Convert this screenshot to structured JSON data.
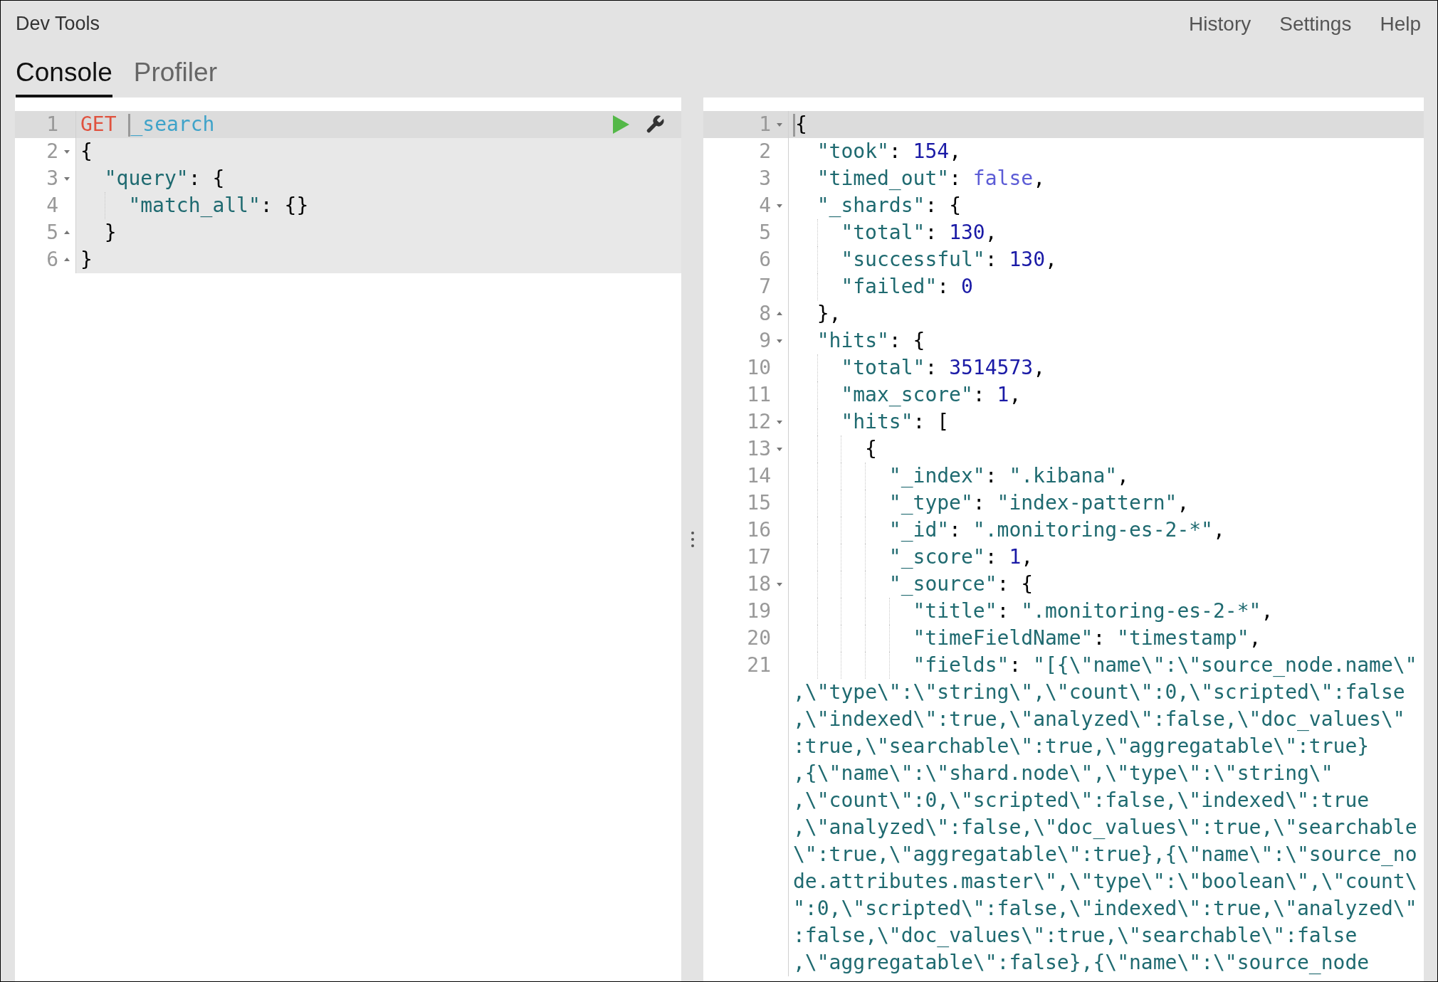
{
  "app_title": "Dev Tools",
  "header_links": [
    "History",
    "Settings",
    "Help"
  ],
  "tabs": [
    {
      "label": "Console",
      "selected": true
    },
    {
      "label": "Profiler",
      "selected": false
    }
  ],
  "request_editor": {
    "lines": [
      {
        "number": "1",
        "fold_start": false,
        "fold_end": false,
        "active": true,
        "in_request": true,
        "tokens": [
          {
            "kind": "method",
            "t": "GET"
          },
          {
            "kind": "cursor"
          },
          {
            "kind": "path",
            "t": "_search"
          }
        ]
      },
      {
        "number": "2",
        "fold_start": true,
        "fold_end": false,
        "active": false,
        "in_request": true,
        "tokens": [
          {
            "kind": "punct",
            "t": "{"
          }
        ]
      },
      {
        "number": "3",
        "fold_start": true,
        "fold_end": false,
        "active": false,
        "in_request": true,
        "tokens": [
          {
            "kind": "key",
            "t": "  \"query\""
          },
          {
            "kind": "punct",
            "t": ": {"
          }
        ]
      },
      {
        "number": "4",
        "fold_start": false,
        "fold_end": false,
        "active": false,
        "in_request": true,
        "tokens": [
          {
            "kind": "key",
            "t": "    \"match_all\""
          },
          {
            "kind": "punct",
            "t": ": {}"
          }
        ]
      },
      {
        "number": "5",
        "fold_start": false,
        "fold_end": true,
        "active": false,
        "in_request": true,
        "tokens": [
          {
            "kind": "punct",
            "t": "  }"
          }
        ]
      },
      {
        "number": "6",
        "fold_start": false,
        "fold_end": true,
        "active": false,
        "in_request": true,
        "tokens": [
          {
            "kind": "punct",
            "t": "}"
          }
        ]
      }
    ]
  },
  "response_editor": {
    "lines": [
      {
        "number": "1",
        "fold_start": true,
        "fold_end": false,
        "active": true,
        "tokens": [
          {
            "kind": "cursor"
          },
          {
            "kind": "punct",
            "t": "{"
          }
        ]
      },
      {
        "number": "2",
        "fold_start": false,
        "fold_end": false,
        "active": false,
        "tokens": [
          {
            "kind": "key",
            "t": "  \"took\""
          },
          {
            "kind": "punct",
            "t": ": "
          },
          {
            "kind": "number",
            "t": "154"
          },
          {
            "kind": "punct",
            "t": ","
          }
        ]
      },
      {
        "number": "3",
        "fold_start": false,
        "fold_end": false,
        "active": false,
        "tokens": [
          {
            "kind": "key",
            "t": "  \"timed_out\""
          },
          {
            "kind": "punct",
            "t": ": "
          },
          {
            "kind": "bool",
            "t": "false"
          },
          {
            "kind": "punct",
            "t": ","
          }
        ]
      },
      {
        "number": "4",
        "fold_start": true,
        "fold_end": false,
        "active": false,
        "tokens": [
          {
            "kind": "key",
            "t": "  \"_shards\""
          },
          {
            "kind": "punct",
            "t": ": {"
          }
        ]
      },
      {
        "number": "5",
        "fold_start": false,
        "fold_end": false,
        "active": false,
        "tokens": [
          {
            "kind": "key",
            "t": "    \"total\""
          },
          {
            "kind": "punct",
            "t": ": "
          },
          {
            "kind": "number",
            "t": "130"
          },
          {
            "kind": "punct",
            "t": ","
          }
        ]
      },
      {
        "number": "6",
        "fold_start": false,
        "fold_end": false,
        "active": false,
        "tokens": [
          {
            "kind": "key",
            "t": "    \"successful\""
          },
          {
            "kind": "punct",
            "t": ": "
          },
          {
            "kind": "number",
            "t": "130"
          },
          {
            "kind": "punct",
            "t": ","
          }
        ]
      },
      {
        "number": "7",
        "fold_start": false,
        "fold_end": false,
        "active": false,
        "tokens": [
          {
            "kind": "key",
            "t": "    \"failed\""
          },
          {
            "kind": "punct",
            "t": ": "
          },
          {
            "kind": "number",
            "t": "0"
          }
        ]
      },
      {
        "number": "8",
        "fold_start": false,
        "fold_end": true,
        "active": false,
        "tokens": [
          {
            "kind": "punct",
            "t": "  },"
          }
        ]
      },
      {
        "number": "9",
        "fold_start": true,
        "fold_end": false,
        "active": false,
        "tokens": [
          {
            "kind": "key",
            "t": "  \"hits\""
          },
          {
            "kind": "punct",
            "t": ": {"
          }
        ]
      },
      {
        "number": "10",
        "fold_start": false,
        "fold_end": false,
        "active": false,
        "tokens": [
          {
            "kind": "key",
            "t": "    \"total\""
          },
          {
            "kind": "punct",
            "t": ": "
          },
          {
            "kind": "number",
            "t": "3514573"
          },
          {
            "kind": "punct",
            "t": ","
          }
        ]
      },
      {
        "number": "11",
        "fold_start": false,
        "fold_end": false,
        "active": false,
        "tokens": [
          {
            "kind": "key",
            "t": "    \"max_score\""
          },
          {
            "kind": "punct",
            "t": ": "
          },
          {
            "kind": "number",
            "t": "1"
          },
          {
            "kind": "punct",
            "t": ","
          }
        ]
      },
      {
        "number": "12",
        "fold_start": true,
        "fold_end": false,
        "active": false,
        "tokens": [
          {
            "kind": "key",
            "t": "    \"hits\""
          },
          {
            "kind": "punct",
            "t": ": ["
          }
        ]
      },
      {
        "number": "13",
        "fold_start": true,
        "fold_end": false,
        "active": false,
        "tokens": [
          {
            "kind": "punct",
            "t": "      {"
          }
        ]
      },
      {
        "number": "14",
        "fold_start": false,
        "fold_end": false,
        "active": false,
        "tokens": [
          {
            "kind": "key",
            "t": "        \"_index\""
          },
          {
            "kind": "punct",
            "t": ": "
          },
          {
            "kind": "string",
            "t": "\".kibana\""
          },
          {
            "kind": "punct",
            "t": ","
          }
        ]
      },
      {
        "number": "15",
        "fold_start": false,
        "fold_end": false,
        "active": false,
        "tokens": [
          {
            "kind": "key",
            "t": "        \"_type\""
          },
          {
            "kind": "punct",
            "t": ": "
          },
          {
            "kind": "string",
            "t": "\"index-pattern\""
          },
          {
            "kind": "punct",
            "t": ","
          }
        ]
      },
      {
        "number": "16",
        "fold_start": false,
        "fold_end": false,
        "active": false,
        "tokens": [
          {
            "kind": "key",
            "t": "        \"_id\""
          },
          {
            "kind": "punct",
            "t": ": "
          },
          {
            "kind": "string",
            "t": "\".monitoring-es-2-*\""
          },
          {
            "kind": "punct",
            "t": ","
          }
        ]
      },
      {
        "number": "17",
        "fold_start": false,
        "fold_end": false,
        "active": false,
        "tokens": [
          {
            "kind": "key",
            "t": "        \"_score\""
          },
          {
            "kind": "punct",
            "t": ": "
          },
          {
            "kind": "number",
            "t": "1"
          },
          {
            "kind": "punct",
            "t": ","
          }
        ]
      },
      {
        "number": "18",
        "fold_start": true,
        "fold_end": false,
        "active": false,
        "tokens": [
          {
            "kind": "key",
            "t": "        \"_source\""
          },
          {
            "kind": "punct",
            "t": ": {"
          }
        ]
      },
      {
        "number": "19",
        "fold_start": false,
        "fold_end": false,
        "active": false,
        "tokens": [
          {
            "kind": "key",
            "t": "          \"title\""
          },
          {
            "kind": "punct",
            "t": ": "
          },
          {
            "kind": "string",
            "t": "\".monitoring-es-2-*\""
          },
          {
            "kind": "punct",
            "t": ","
          }
        ]
      },
      {
        "number": "20",
        "fold_start": false,
        "fold_end": false,
        "active": false,
        "tokens": [
          {
            "kind": "key",
            "t": "          \"timeFieldName\""
          },
          {
            "kind": "punct",
            "t": ": "
          },
          {
            "kind": "string",
            "t": "\"timestamp\""
          },
          {
            "kind": "punct",
            "t": ","
          }
        ]
      },
      {
        "number": "21",
        "fold_start": false,
        "fold_end": false,
        "active": false,
        "tokens": [
          {
            "kind": "key",
            "t": "          \"fields\""
          },
          {
            "kind": "punct",
            "t": ": "
          },
          {
            "kind": "string",
            "t": "\"[{\\\"name\\\":\\\"source_node.name\\\""
          }
        ],
        "wrapped": [
          ",\\\"type\\\":\\\"string\\\",\\\"count\\\":0,\\\"scripted\\\":false",
          ",\\\"indexed\\\":true,\\\"analyzed\\\":false,\\\"doc_values\\\"",
          ":true,\\\"searchable\\\":true,\\\"aggregatable\\\":true}",
          ",{\\\"name\\\":\\\"shard.node\\\",\\\"type\\\":\\\"string\\\"",
          ",\\\"count\\\":0,\\\"scripted\\\":false,\\\"indexed\\\":true",
          ",\\\"analyzed\\\":false,\\\"doc_values\\\":true,\\\"searchable",
          "\\\":true,\\\"aggregatable\\\":true},{\\\"name\\\":\\\"source_no",
          "de.attributes.master\\\",\\\"type\\\":\\\"boolean\\\",\\\"count\\",
          "\":0,\\\"scripted\\\":false,\\\"indexed\\\":true,\\\"analyzed\\\"",
          ":false,\\\"doc_values\\\":true,\\\"searchable\\\":false",
          ",\\\"aggregatable\\\":false},{\\\"name\\\":\\\"source_node"
        ]
      }
    ]
  }
}
